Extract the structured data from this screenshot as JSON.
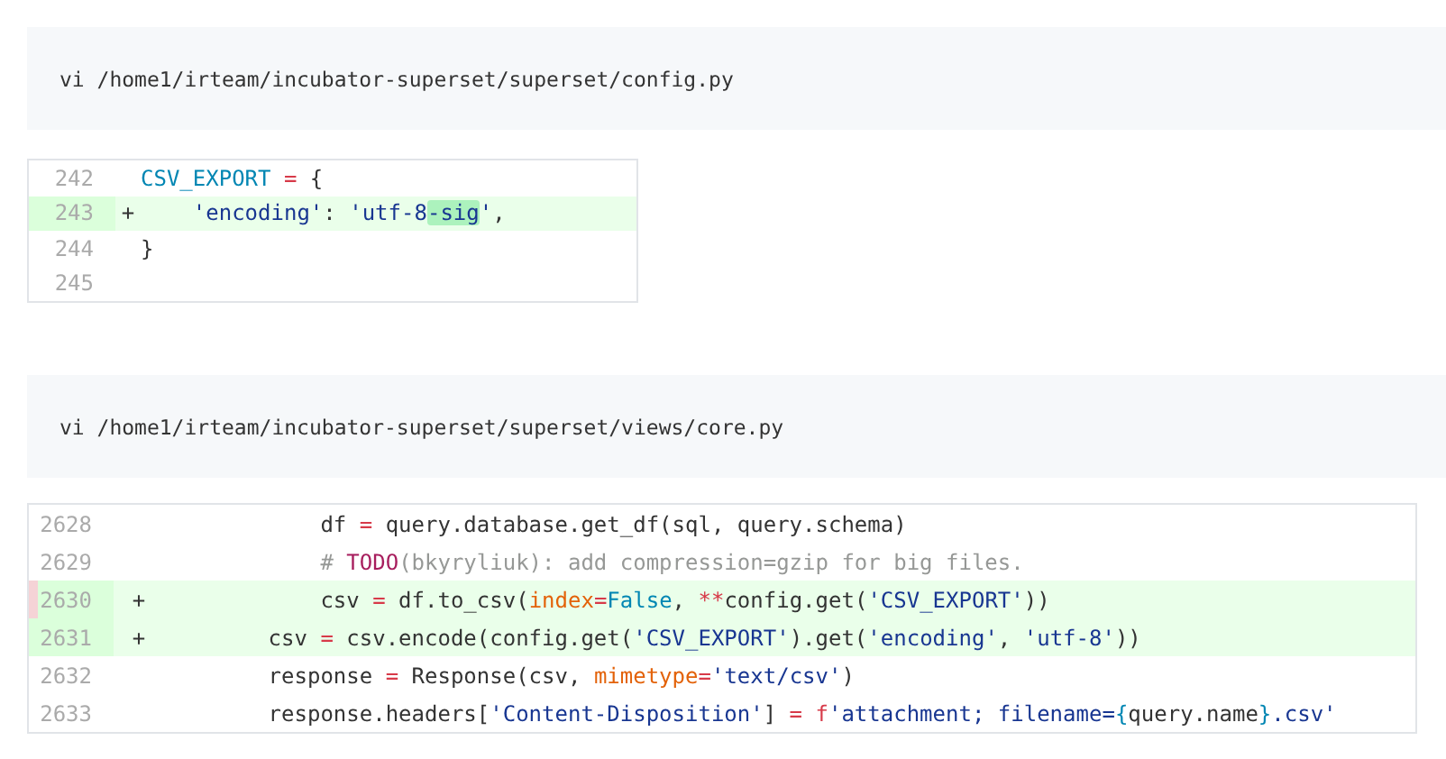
{
  "sections": [
    {
      "command": "vi /home1/irteam/incubator-superset/superset/config.py",
      "diff": {
        "lines": [
          {
            "number": "242",
            "added": false,
            "flagged": false,
            "tokens": [
              {
                "text": "CSV_EXPORT",
                "kind": "name"
              },
              {
                "text": " =",
                "kind": "operator"
              },
              {
                "text": " {",
                "kind": "plain"
              }
            ]
          },
          {
            "number": "243",
            "added": true,
            "marker": "+",
            "flagged": false,
            "tokens": [
              {
                "text": "    'encoding'",
                "kind": "string"
              },
              {
                "text": ": ",
                "kind": "plain"
              },
              {
                "text": "'utf-8",
                "kind": "string"
              },
              {
                "text": "-sig",
                "kind": "string",
                "changed": true
              },
              {
                "text": "'",
                "kind": "string"
              },
              {
                "text": ",",
                "kind": "plain"
              }
            ]
          },
          {
            "number": "244",
            "added": false,
            "flagged": false,
            "tokens": [
              {
                "text": "}",
                "kind": "plain"
              }
            ]
          },
          {
            "number": "245",
            "added": false,
            "flagged": false
          }
        ]
      }
    },
    {
      "command": "vi /home1/irteam/incubator-superset/superset/views/core.py",
      "diff": {
        "lines": [
          {
            "number": "2628",
            "added": false,
            "flagged": false,
            "tokens": [
              {
                "text": "            df ",
                "kind": "plain"
              },
              {
                "text": "=",
                "kind": "operator"
              },
              {
                "text": " query.database.get_df(sql, query.schema)",
                "kind": "plain"
              }
            ]
          },
          {
            "number": "2629",
            "added": false,
            "flagged": false,
            "tokens": [
              {
                "text": "            # ",
                "kind": "comment"
              },
              {
                "text": "TODO",
                "kind": "todo"
              },
              {
                "text": "(bkyryliuk): add compression=gzip for big files.",
                "kind": "comment"
              }
            ]
          },
          {
            "number": "2630",
            "added": true,
            "marker": "+",
            "flagged": true,
            "tokens": [
              {
                "text": "            csv ",
                "kind": "plain"
              },
              {
                "text": "=",
                "kind": "operator"
              },
              {
                "text": " df.to_csv(",
                "kind": "plain"
              },
              {
                "text": "index",
                "kind": "keyword"
              },
              {
                "text": "=",
                "kind": "operator"
              },
              {
                "text": "False",
                "kind": "constant"
              },
              {
                "text": ", ",
                "kind": "plain"
              },
              {
                "text": "**",
                "kind": "operator"
              },
              {
                "text": "config.get(",
                "kind": "plain"
              },
              {
                "text": "'CSV_EXPORT'",
                "kind": "string"
              },
              {
                "text": "))",
                "kind": "plain"
              }
            ]
          },
          {
            "number": "2631",
            "added": true,
            "marker": "+",
            "flagged": false,
            "tokens": [
              {
                "text": "        csv ",
                "kind": "plain"
              },
              {
                "text": "=",
                "kind": "operator"
              },
              {
                "text": " csv.encode(config.get(",
                "kind": "plain"
              },
              {
                "text": "'CSV_EXPORT'",
                "kind": "string"
              },
              {
                "text": ").get(",
                "kind": "plain"
              },
              {
                "text": "'encoding'",
                "kind": "string"
              },
              {
                "text": ", ",
                "kind": "plain"
              },
              {
                "text": "'utf-8'",
                "kind": "string"
              },
              {
                "text": "))",
                "kind": "plain"
              }
            ]
          },
          {
            "number": "2632",
            "added": false,
            "flagged": false,
            "tokens": [
              {
                "text": "        response ",
                "kind": "plain"
              },
              {
                "text": "=",
                "kind": "operator"
              },
              {
                "text": " Response(csv, ",
                "kind": "plain"
              },
              {
                "text": "mimetype",
                "kind": "keyword"
              },
              {
                "text": "=",
                "kind": "operator"
              },
              {
                "text": "'text/csv'",
                "kind": "string"
              },
              {
                "text": ")",
                "kind": "plain"
              }
            ]
          },
          {
            "number": "2633",
            "added": false,
            "flagged": false,
            "tokens": [
              {
                "text": "        response.headers[",
                "kind": "plain"
              },
              {
                "text": "'Content-Disposition'",
                "kind": "string"
              },
              {
                "text": "] ",
                "kind": "plain"
              },
              {
                "text": "=",
                "kind": "operator"
              },
              {
                "text": " f",
                "kind": "operator"
              },
              {
                "text": "'attachment; filename=",
                "kind": "string"
              },
              {
                "text": "{",
                "kind": "name"
              },
              {
                "text": "query.name",
                "kind": "plain"
              },
              {
                "text": "}",
                "kind": "name"
              },
              {
                "text": ".csv'",
                "kind": "string"
              }
            ]
          }
        ]
      }
    }
  ]
}
